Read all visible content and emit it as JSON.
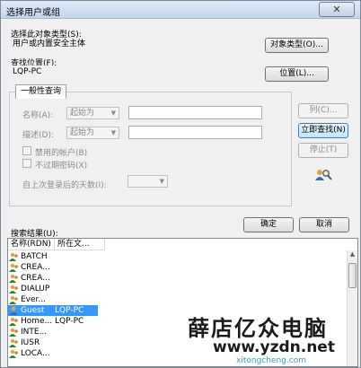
{
  "window": {
    "title": "选择用户或组",
    "close_symbol": "✕"
  },
  "object_type": {
    "label": "选择此对象类型(S):",
    "value": "用户或内置安全主体",
    "button": "对象类型(O)..."
  },
  "location": {
    "label": "查找位置(F):",
    "value": "LQP-PC",
    "button": "位置(L)..."
  },
  "query": {
    "tab": "一般性查询",
    "name_label": "名称(A):",
    "name_op": "起始为",
    "desc_label": "描述(D):",
    "desc_op": "起始为",
    "disabled_accounts": "禁用的帐户(B)",
    "no_expire": "不过期密码(X)",
    "days_label": "自上次登录后的天数(I):"
  },
  "side_buttons": {
    "columns": "列(C)...",
    "find_now": "立即查找(N)",
    "stop": "停止(T)"
  },
  "ok": "确定",
  "cancel": "取消",
  "results": {
    "label": "搜索结果(U):",
    "columns": [
      "名称(RDN)",
      "所在文..."
    ],
    "rows": [
      {
        "name": "BATCH",
        "folder": ""
      },
      {
        "name": "CREA...",
        "folder": ""
      },
      {
        "name": "CREA...",
        "folder": ""
      },
      {
        "name": "DIALUP",
        "folder": ""
      },
      {
        "name": "Ever...",
        "folder": ""
      },
      {
        "name": "Guest",
        "folder": "LQP-PC",
        "selected": true
      },
      {
        "name": "Home...",
        "folder": "LQP-PC"
      },
      {
        "name": "INTE...",
        "folder": ""
      },
      {
        "name": "IUSR",
        "folder": ""
      },
      {
        "name": "LOCA...",
        "folder": ""
      }
    ]
  },
  "watermark": {
    "title": "薛店亿众电脑",
    "url": "www.yzdn.net",
    "sub": "xitongcheng.com"
  },
  "colors": {
    "selection": "#3399ff",
    "title_bar": "#c4d5ea"
  }
}
